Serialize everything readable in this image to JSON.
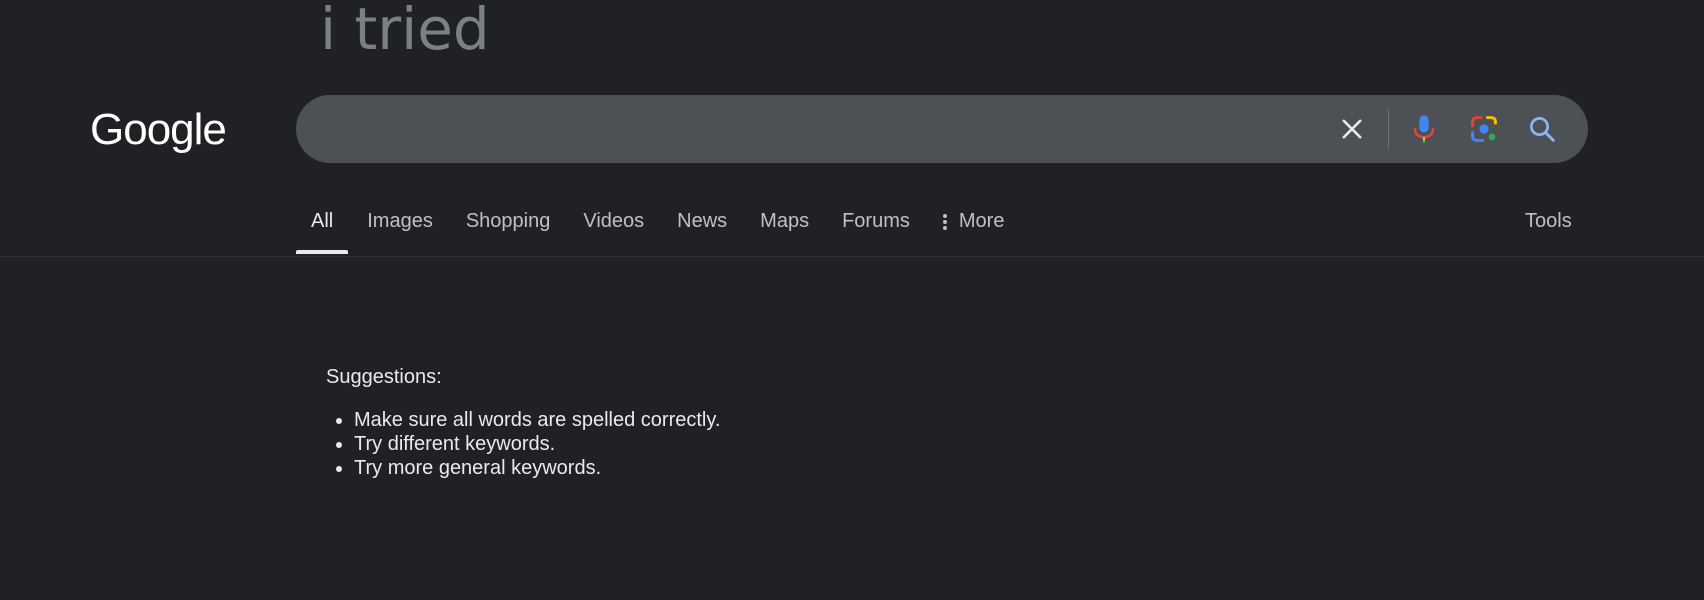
{
  "overlay": {
    "query_text": "i tried"
  },
  "header": {
    "logo_text": "Google",
    "search": {
      "value": "",
      "clear_icon": "close-icon",
      "mic_icon": "microphone-icon",
      "lens_icon": "google-lens-icon",
      "search_icon": "search-icon"
    }
  },
  "tabs": {
    "items": [
      {
        "label": "All",
        "active": true
      },
      {
        "label": "Images"
      },
      {
        "label": "Shopping"
      },
      {
        "label": "Videos"
      },
      {
        "label": "News"
      },
      {
        "label": "Maps"
      },
      {
        "label": "Forums"
      },
      {
        "label": "More",
        "icon": "vertical-dots-icon"
      }
    ],
    "tools_label": "Tools"
  },
  "results": {
    "suggestions_title": "Suggestions:",
    "suggestions": [
      "Make sure all words are spelled correctly.",
      "Try different keywords.",
      "Try more general keywords."
    ]
  },
  "colors": {
    "background": "#202124",
    "searchbox": "#4d5156",
    "text_primary": "#e8eaed",
    "text_secondary": "#bdc1c6",
    "google_blue": "#4285f4",
    "google_red": "#ea4335",
    "google_yellow": "#fbbc04",
    "google_green": "#34a853"
  }
}
